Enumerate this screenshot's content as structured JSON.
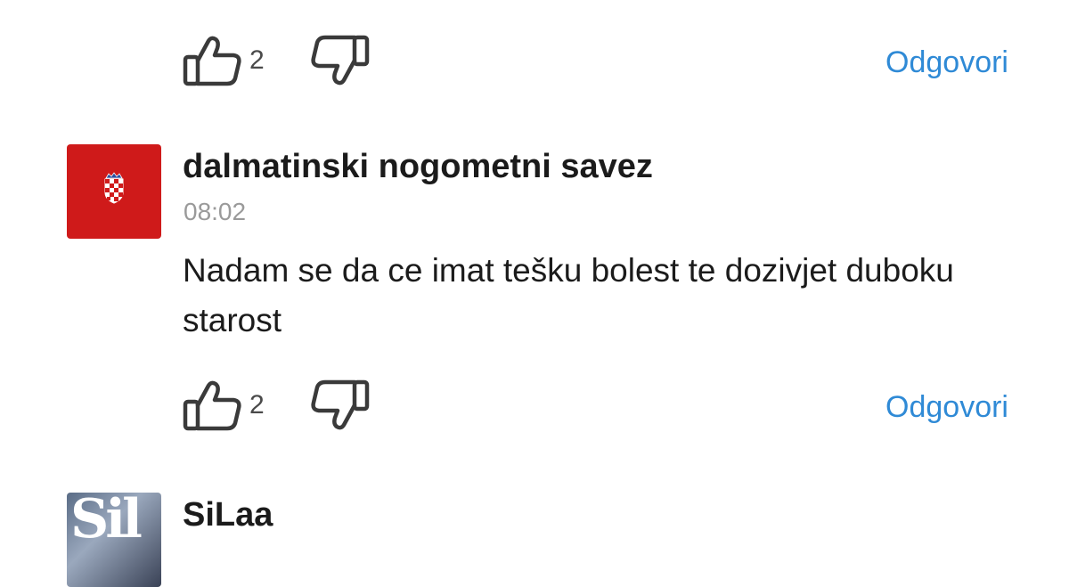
{
  "comments_top": {
    "likes": "2",
    "reply_label": "Odgovori"
  },
  "comment1": {
    "author": "dalmatinski nogometni savez",
    "time": "08:02",
    "text": "Nadam se da ce imat tešku bolest te dozivjet duboku starost",
    "likes": "2",
    "reply_label": "Odgovori",
    "avatar_color": "#cf1a1a"
  },
  "comment2": {
    "author": "SiLaa"
  },
  "icons": {
    "like": "thumbs-up-icon",
    "dislike": "thumbs-down-icon",
    "avatar_emblem": "croatian-checkerboard-crest-icon"
  },
  "colors": {
    "link": "#2f8ad6",
    "timestamp": "#9a9a9a",
    "text": "#1b1b1b"
  }
}
